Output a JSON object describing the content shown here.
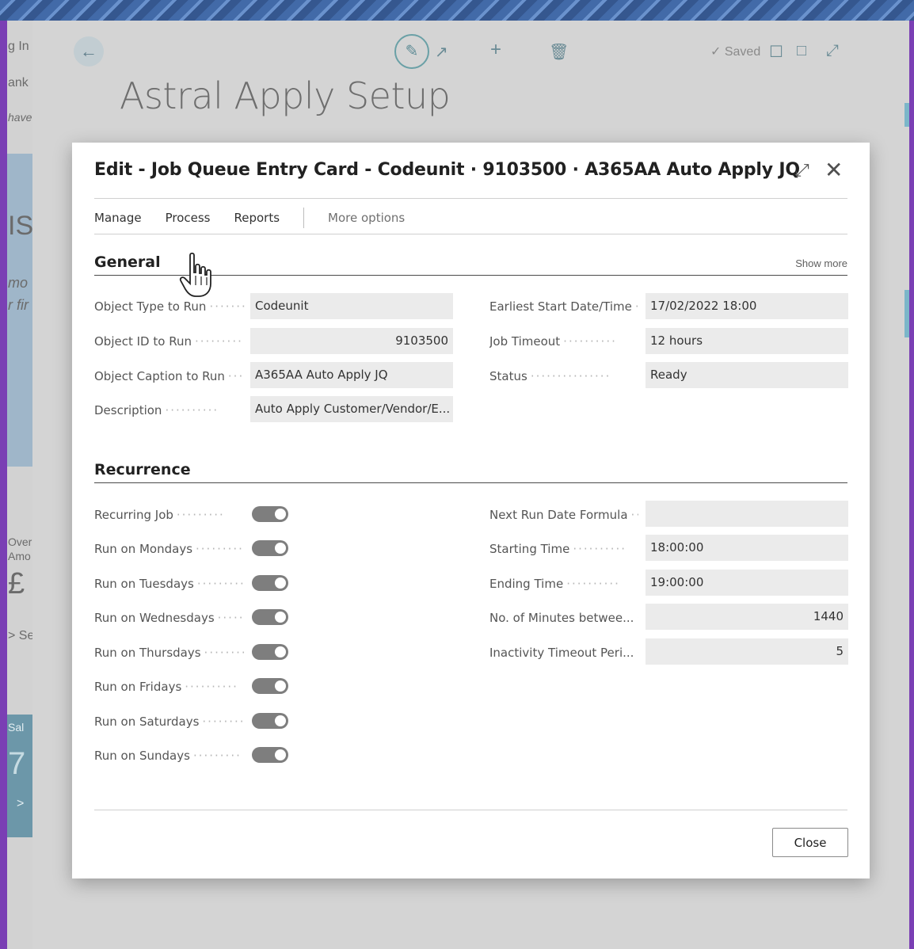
{
  "background": {
    "left_snippets": [
      "g In",
      "ank",
      "have",
      "IS",
      "mo",
      "r fir",
      "Over",
      "Amo",
      "£",
      "> Se",
      "Sal",
      "7",
      ">"
    ],
    "saved_label": "Saved",
    "page_title": "Astral Apply Setup"
  },
  "modal": {
    "title": "Edit - Job Queue Entry Card - Codeunit · 9103500 · A365AA Auto Apply JQ",
    "menu": [
      "Manage",
      "Process",
      "Reports",
      "More options"
    ],
    "show_more": "Show more",
    "close_label": "Close",
    "general": {
      "title": "General",
      "left": [
        {
          "label": "Object Type to Run",
          "value": "Codeunit"
        },
        {
          "label": "Object ID to Run",
          "value": "9103500"
        },
        {
          "label": "Object Caption to Run",
          "value": "A365AA Auto Apply JQ"
        },
        {
          "label": "Description",
          "value": "Auto Apply Customer/Vendor/E..."
        }
      ],
      "right": [
        {
          "label": "Earliest Start Date/Time",
          "value": "17/02/2022 18:00"
        },
        {
          "label": "Job Timeout",
          "value": "12 hours"
        },
        {
          "label": "Status",
          "value": "Ready"
        }
      ]
    },
    "recurrence": {
      "title": "Recurrence",
      "toggles": [
        {
          "label": "Recurring Job",
          "on": true
        },
        {
          "label": "Run on Mondays",
          "on": true
        },
        {
          "label": "Run on Tuesdays",
          "on": true
        },
        {
          "label": "Run on Wednesdays",
          "on": true
        },
        {
          "label": "Run on Thursdays",
          "on": true
        },
        {
          "label": "Run on Fridays",
          "on": true
        },
        {
          "label": "Run on Saturdays",
          "on": true
        },
        {
          "label": "Run on Sundays",
          "on": true
        }
      ],
      "right": [
        {
          "label": "Next Run Date Formula",
          "value": ""
        },
        {
          "label": "Starting Time",
          "value": "18:00:00"
        },
        {
          "label": "Ending Time",
          "value": "19:00:00"
        },
        {
          "label": "No. of Minutes betwee...",
          "value": "1440"
        },
        {
          "label": "Inactivity Timeout Peri...",
          "value": "5"
        }
      ]
    }
  },
  "icons": [
    "back-arrow-icon",
    "pencil-icon",
    "share-icon",
    "plus-icon",
    "trash-icon",
    "check-icon",
    "bookmark-icon",
    "open-new-icon",
    "expand-icon",
    "close-icon",
    "hand-cursor-icon"
  ]
}
